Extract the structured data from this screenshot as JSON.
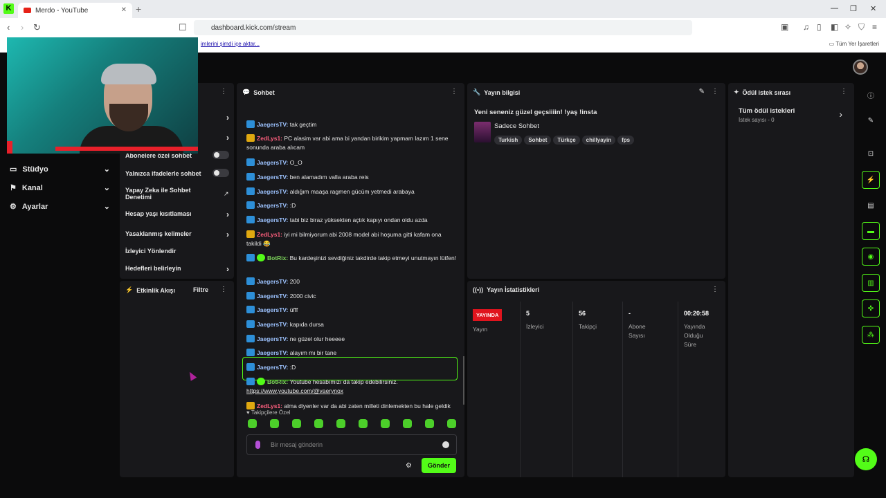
{
  "browser": {
    "tab_title": "Merdo - YouTube",
    "url": "dashboard.kick.com/stream",
    "bookmark_prompt": "imlerini şimdi içe aktar...",
    "all_bookmarks": "Tüm Yer İşaretleri"
  },
  "leftnav": {
    "items": [
      {
        "label": "Stüdyo"
      },
      {
        "label": "Kanal"
      },
      {
        "label": "Ayarlar"
      }
    ]
  },
  "settings_panel": {
    "rows": [
      "Abonelere özel sohbet",
      "Yalnızca ifadelerle sohbet",
      "Yapay Zeka ile Sohbet Denetimi",
      "Hesap yaşı kısıtlaması",
      "Yasaklanmış kelimeler",
      "İzleyici Yönlendir",
      "Hedefleri belirleyin"
    ]
  },
  "activity": {
    "title": "Etkinlik Akışı",
    "filter": "Filtre"
  },
  "chat": {
    "title": "Sohbet",
    "messages": [
      {
        "user": "JaegersTV",
        "text": "tak geçtim"
      },
      {
        "user": "ZedLys1",
        "text": "PC alasim var abi ama bi yandan birikim yapmam lazım 1 sene sonunda araba alıcam"
      },
      {
        "user": "JaegersTV",
        "text": "O_O"
      },
      {
        "user": "JaegersTV",
        "text": "ben alamadım valla araba reis"
      },
      {
        "user": "JaegersTV",
        "text": "aldığım maaşa ragmen gücüm yetmedi arabaya"
      },
      {
        "user": "JaegersTV",
        "text": ":D"
      },
      {
        "user": "JaegersTV",
        "text": "tabi biz biraz yüksekten açtık kapıyı ondan oldu azda"
      },
      {
        "user": "ZedLys1",
        "text": "iyi mi bilmiyorum abi 2008 model abi hoşuma gitti kafam ona takildi 😂"
      },
      {
        "user": "BotRix",
        "text": "Bu kardeşinizi sevdiğiniz takdirde takip etmeyi unutmayın lütfen!"
      },
      {
        "user": "JaegersTV",
        "text": "200"
      },
      {
        "user": "JaegersTV",
        "text": "2000 civic"
      },
      {
        "user": "JaegersTV",
        "text": "üfff"
      },
      {
        "user": "JaegersTV",
        "text": "kapıda dursa"
      },
      {
        "user": "JaegersTV",
        "text": "ne güzel olur heeeee"
      },
      {
        "user": "JaegersTV",
        "text": "alayım mı bir tane"
      },
      {
        "user": "JaegersTV",
        "text": ":D"
      },
      {
        "user": "BotRix",
        "text": "Youtube hesabımızı da takip edebilirsiniz.",
        "link": "https://www.youtube.com/@vaerynox"
      },
      {
        "user": "ZedLys1",
        "text": "alma diyenler var da abi zaten milleti dinlemekten bu hale geldik"
      }
    ],
    "followers_only": "Takipçilere Özel",
    "input_placeholder": "Bir mesaj gönderin",
    "send_label": "Gönder"
  },
  "stream_info": {
    "title": "Yayın bilgisi",
    "stream_title": "Yeni seneniz güzel geçsiiiin! !yaş !insta",
    "category": "Sadece Sohbet",
    "tags": [
      "Turkish",
      "Sohbet",
      "Türkçe",
      "chillyayin",
      "fps"
    ]
  },
  "stats": {
    "title": "Yayın İstatistikleri",
    "live_label": "YAYINDA",
    "columns": [
      {
        "value": "",
        "label": "Yayın"
      },
      {
        "value": "5",
        "label": "İzleyici"
      },
      {
        "value": "56",
        "label": "Takipçi"
      },
      {
        "value": "-",
        "label": "Abone Sayısı"
      },
      {
        "value": "00:20:58",
        "label": "Yayında Olduğu Süre"
      }
    ]
  },
  "rewards": {
    "title": "Ödül istek sırası",
    "all_requests": "Tüm ödül istekleri",
    "count_label": "İstek sayısı - 0"
  }
}
